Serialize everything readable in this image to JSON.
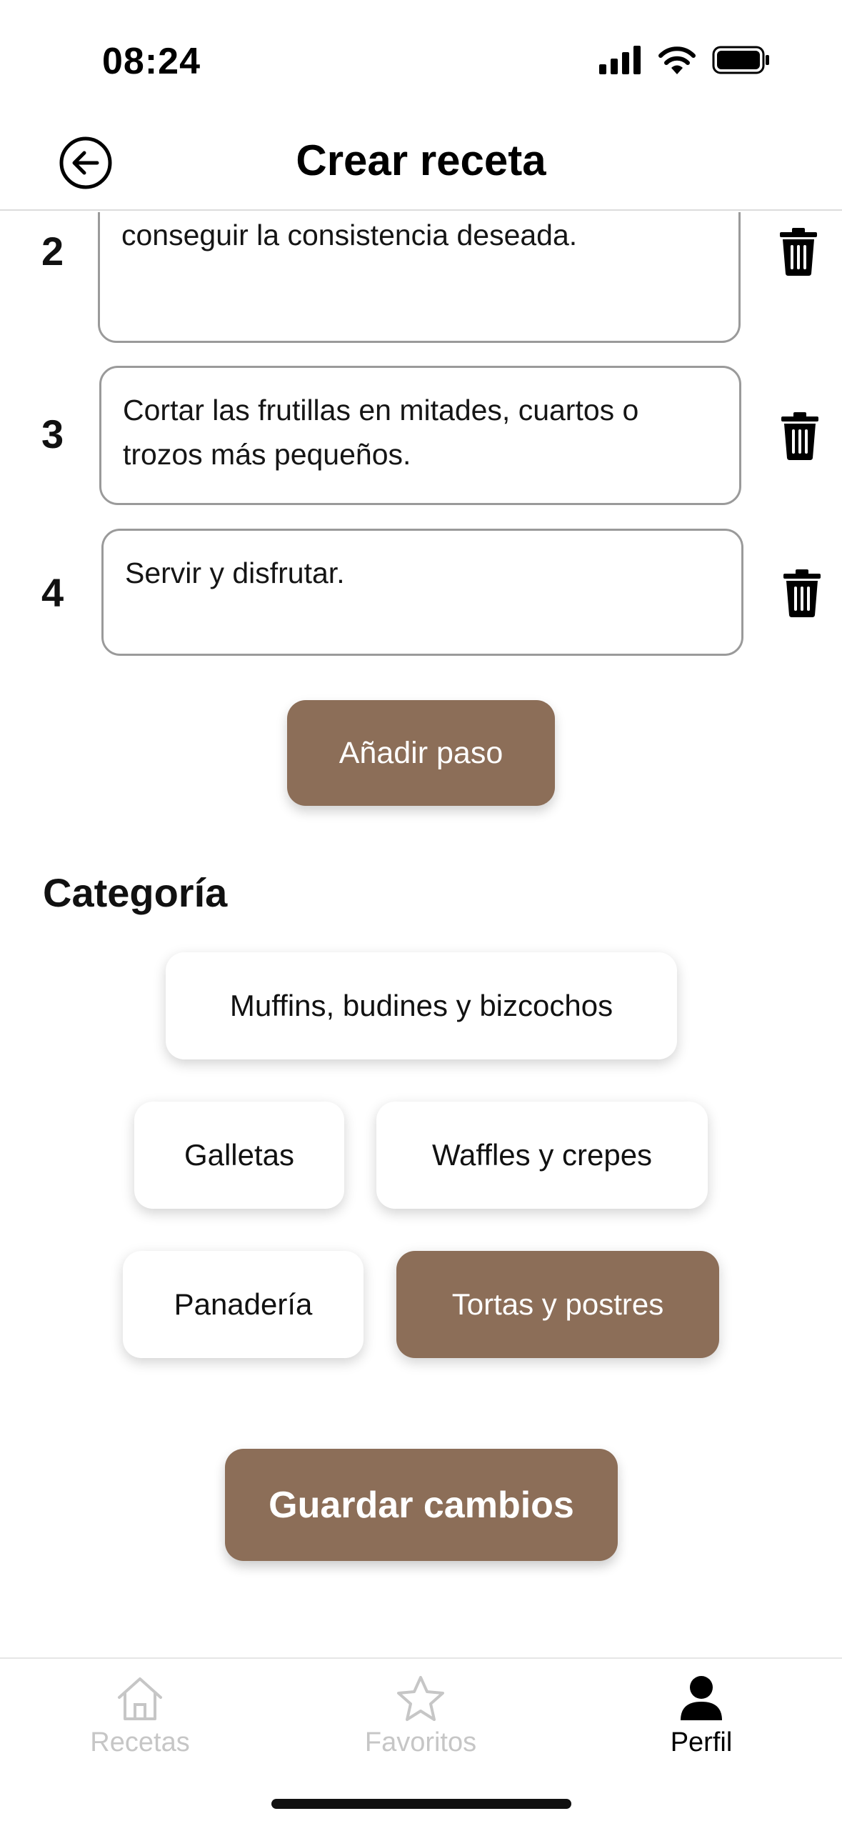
{
  "status_bar": {
    "time": "08:24"
  },
  "header": {
    "title": "Crear receta",
    "back_icon": "arrow-left-circle-icon"
  },
  "steps": [
    {
      "number": "2",
      "text": "Batir con batidora eléctrica o manual hasta conseguir la consistencia deseada."
    },
    {
      "number": "3",
      "text": "Cortar las frutillas en mitades, cuartos o trozos más pequeños."
    },
    {
      "number": "4",
      "text": "Servir y disfrutar."
    }
  ],
  "add_step_label": "Añadir paso",
  "category": {
    "title": "Categoría",
    "options": [
      {
        "label": "Muffins, budines y bizcochos",
        "selected": false
      },
      {
        "label": "Galletas",
        "selected": false
      },
      {
        "label": "Waffles y crepes",
        "selected": false
      },
      {
        "label": "Panadería",
        "selected": false
      },
      {
        "label": "Tortas y postres",
        "selected": true
      }
    ]
  },
  "save_label": "Guardar cambios",
  "bottom_nav": [
    {
      "label": "Recetas",
      "icon": "home-icon",
      "active": false
    },
    {
      "label": "Favoritos",
      "icon": "star-icon",
      "active": false
    },
    {
      "label": "Perfil",
      "icon": "user-icon",
      "active": true
    }
  ],
  "colors": {
    "accent": "#8c6e58",
    "inactive": "#c6c6c6",
    "border": "#9a9a9a"
  }
}
